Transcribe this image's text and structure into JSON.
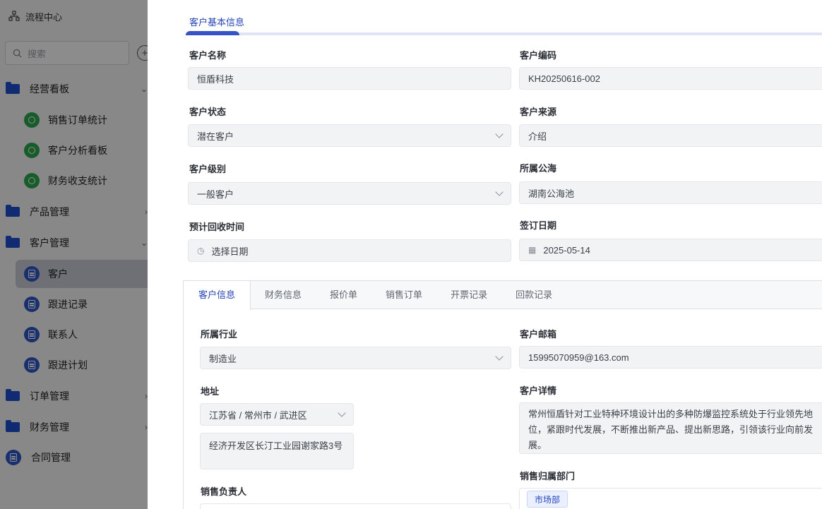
{
  "sidebar": {
    "top_title": "流程中心",
    "search_placeholder": "搜索",
    "groups": {
      "dashboard": "经营看板",
      "sales_order_stats": "销售订单统计",
      "customer_analysis": "客户分析看板",
      "finance_stats": "财务收支统计",
      "product_mgmt": "产品管理",
      "customer_mgmt": "客户管理",
      "customer": "客户",
      "follow_records": "跟进记录",
      "contacts": "联系人",
      "follow_plan": "跟进计划",
      "order_mgmt": "订单管理",
      "finance_mgmt": "财务管理",
      "contract_mgmt": "合同管理"
    }
  },
  "basic": {
    "section_title": "客户基本信息",
    "name_label": "客户名称",
    "name_value": "恒盾科技",
    "code_label": "客户编码",
    "code_value": "KH20250616-002",
    "status_label": "客户状态",
    "status_value": "潜在客户",
    "source_label": "客户来源",
    "source_value": "介绍",
    "level_label": "客户级别",
    "level_value": "一般客户",
    "sea_label": "所属公海",
    "sea_value": "湖南公海池",
    "recover_label": "预计回收时间",
    "recover_placeholder": "选择日期",
    "sign_label": "签订日期",
    "sign_value": "2025-05-14"
  },
  "tabs": [
    "客户信息",
    "财务信息",
    "报价单",
    "销售订单",
    "开票记录",
    "回款记录"
  ],
  "detail": {
    "industry_label": "所属行业",
    "industry_value": "制造业",
    "email_label": "客户邮箱",
    "email_value": "15995070959@163.com",
    "address_label": "地址",
    "region_value": "江苏省 / 常州市 / 武进区",
    "street_value": "经济开发区长汀工业园谢家路3号",
    "intro_label": "客户详情",
    "intro_value": "常州恒盾针对工业特种环境设计出的多种防爆监控系统处于行业领先地位，紧跟时代发展，不断推出新产品、提出新思路，引领该行业向前发展。",
    "owner_label": "销售负责人",
    "dept_label": "销售归属部门",
    "dept_value": "市场部"
  }
}
